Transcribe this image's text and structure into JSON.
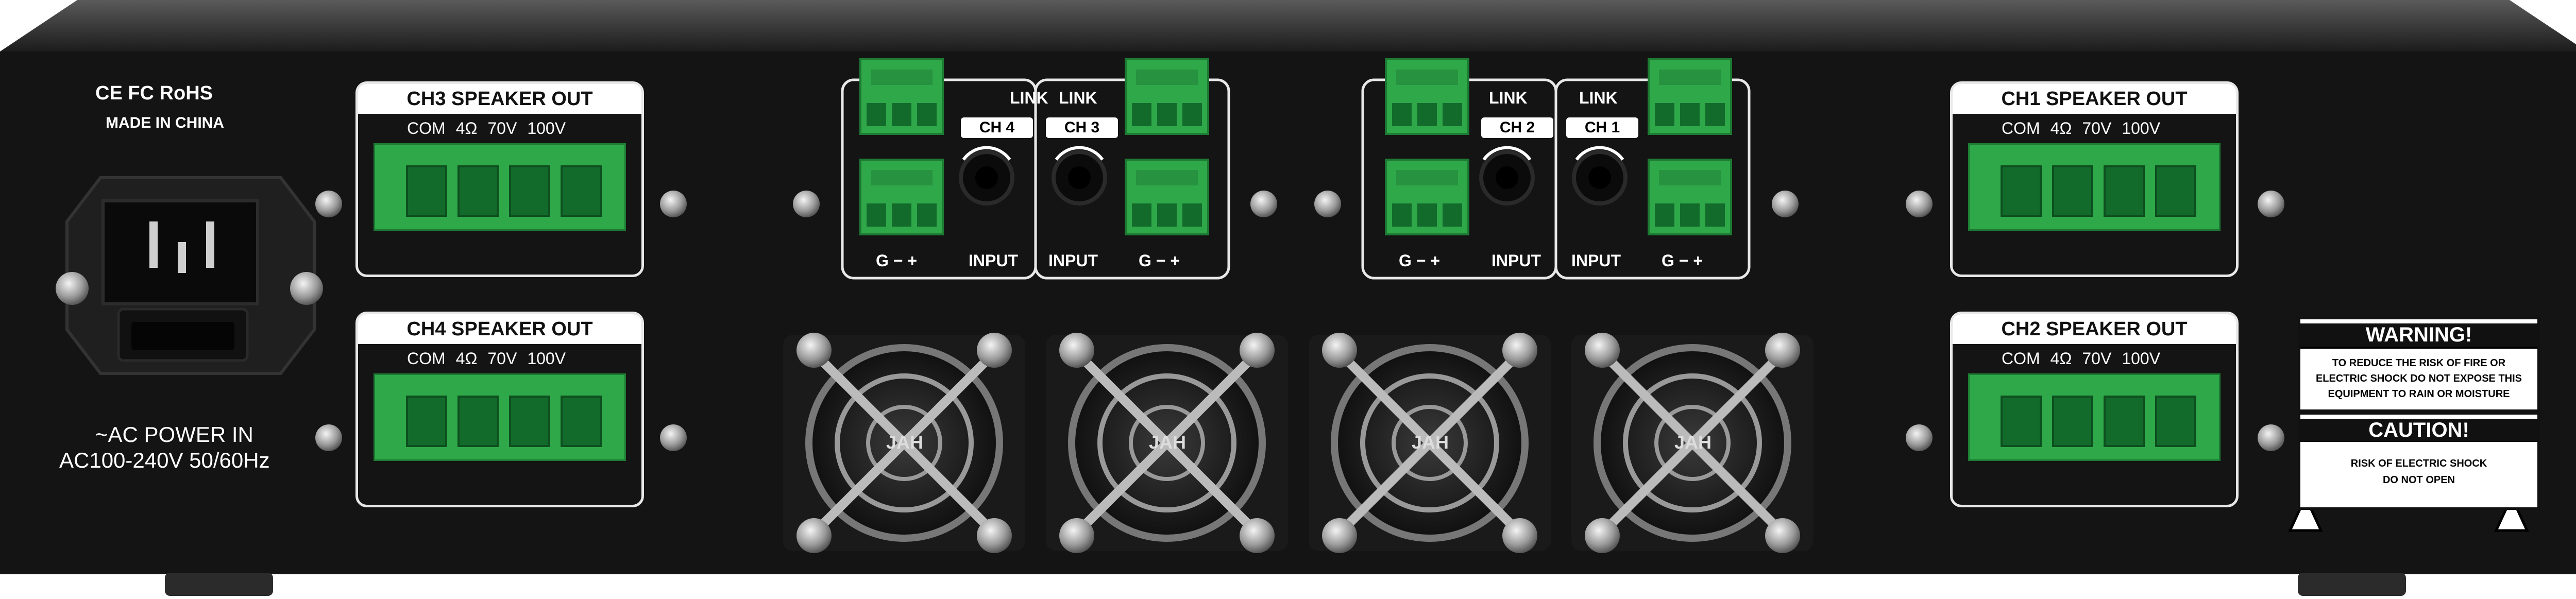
{
  "certifications": "CE FC RoHS",
  "made_in": "MADE IN CHINA",
  "power": {
    "line1": "~AC POWER IN",
    "line2": "AC100-240V 50/60Hz"
  },
  "speaker_outputs": [
    {
      "title": "CH3 SPEAKER OUT",
      "labels": [
        "COM",
        "4Ω",
        "70V",
        "100V"
      ]
    },
    {
      "title": "CH4 SPEAKER OUT",
      "labels": [
        "COM",
        "4Ω",
        "70V",
        "100V"
      ]
    },
    {
      "title": "CH1 SPEAKER OUT",
      "labels": [
        "COM",
        "4Ω",
        "70V",
        "100V"
      ]
    },
    {
      "title": "CH2 SPEAKER OUT",
      "labels": [
        "COM",
        "4Ω",
        "70V",
        "100V"
      ]
    }
  ],
  "inputs": {
    "link_label": "LINK",
    "input_label": "INPUT",
    "pins_label": "G  −  +",
    "channels": [
      "CH 4",
      "CH 3",
      "CH 2",
      "CH 1"
    ]
  },
  "fan_label": "JAH",
  "warning": {
    "title": "WARNING!",
    "text": "TO REDUCE THE RISK OF FIRE OR ELECTRIC SHOCK DO NOT EXPOSE THIS EQUIPMENT TO RAIN OR MOISTURE"
  },
  "caution": {
    "title": "CAUTION!",
    "text_line1": "RISK OF ELECTRIC SHOCK",
    "text_line2": "DO NOT OPEN"
  },
  "colors": {
    "panel": "#151515",
    "terminal_green": "#2fa84a",
    "silkscreen": "#ffffff"
  }
}
